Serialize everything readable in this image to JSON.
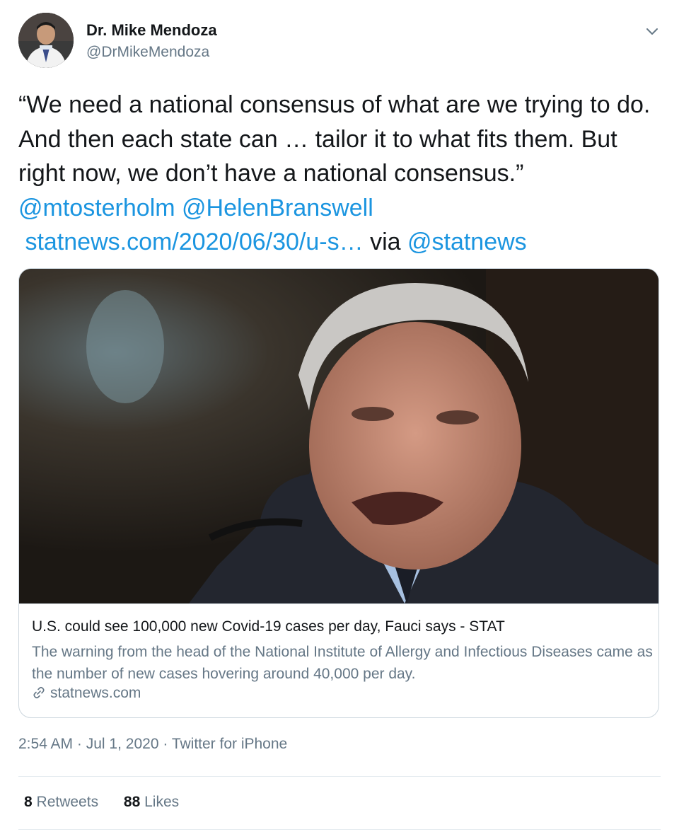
{
  "author": {
    "name": "Dr. Mike Mendoza",
    "handle": "@DrMikeMendoza"
  },
  "tweet": {
    "text_plain": "“We need a national consensus of what are we trying to do. And then each state can … tailor it to what fits them. But right now, we don’t have a national consensus.” ",
    "mention_1": "@mtosterholm",
    "mention_2": "@HelenBranswell",
    "url": "statnews.com/2020/06/30/u-s…",
    "via_label": "via",
    "mention_3": "@statnews"
  },
  "card": {
    "title": "U.S. could see 100,000 new Covid-19 cases per day, Fauci says - STAT",
    "description": "The warning from the head of the National Institute of Allergy and Infectious Diseases came as the number of new cases hovering around 40,000 per day.",
    "domain": "statnews.com"
  },
  "meta": {
    "time": "2:54 AM",
    "date": "Jul 1, 2020",
    "source": "Twitter for iPhone",
    "separator": "·"
  },
  "stats": {
    "retweets_count": "8",
    "retweets_label": "Retweets",
    "likes_count": "88",
    "likes_label": "Likes"
  },
  "colors": {
    "link": "#1b95e0",
    "secondary_text": "#657786",
    "primary_text": "#14171a"
  },
  "icons": {
    "caret": "chevron-down-icon",
    "card_link": "link-icon"
  }
}
